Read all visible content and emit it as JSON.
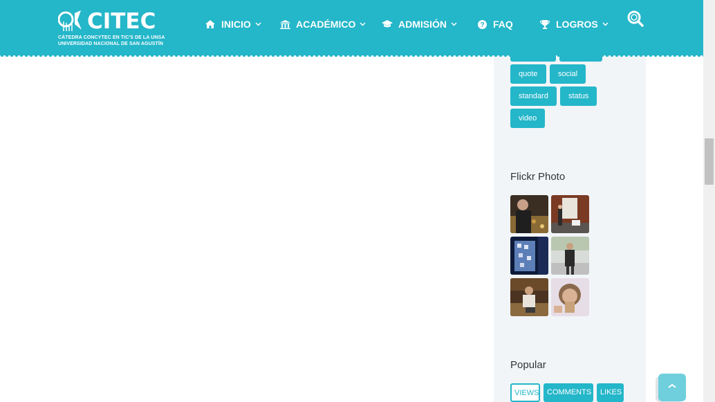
{
  "header": {
    "logo": {
      "wordmark": "CITEC",
      "subtitle_line1": "CÁTEDRA CONCYTEC EN TIC'S DE LA UNSA",
      "subtitle_line2": "UNIVERSIDAD NACIONAL DE SAN AGUSTÍN"
    },
    "nav": [
      {
        "label": "INICIO",
        "icon": "home-icon",
        "has_dropdown": true
      },
      {
        "label": "ACADÉMICO",
        "icon": "university-icon",
        "has_dropdown": true
      },
      {
        "label": "ADMISIÓN",
        "icon": "graduation-cap-icon",
        "has_dropdown": true
      },
      {
        "label": "FAQ",
        "icon": "question-circle-icon",
        "has_dropdown": false
      },
      {
        "label": "LOGROS",
        "icon": "trophy-icon",
        "has_dropdown": true
      }
    ],
    "search_icon": "search-icon"
  },
  "sidebar": {
    "tags": [
      "quote",
      "social",
      "standard",
      "status",
      "video"
    ],
    "flickr": {
      "title": "Flickr Photo"
    },
    "popular": {
      "title": "Popular",
      "tabs": [
        "VIEWS",
        "COMMENTS",
        "LIKES"
      ],
      "active_tab": "VIEWS"
    }
  },
  "colors": {
    "accent": "#24b6c9",
    "sidebar_bg": "#f2f5f8",
    "back_to_top": "#6fcfdc"
  },
  "back_to_top_icon": "chevron-up-icon"
}
